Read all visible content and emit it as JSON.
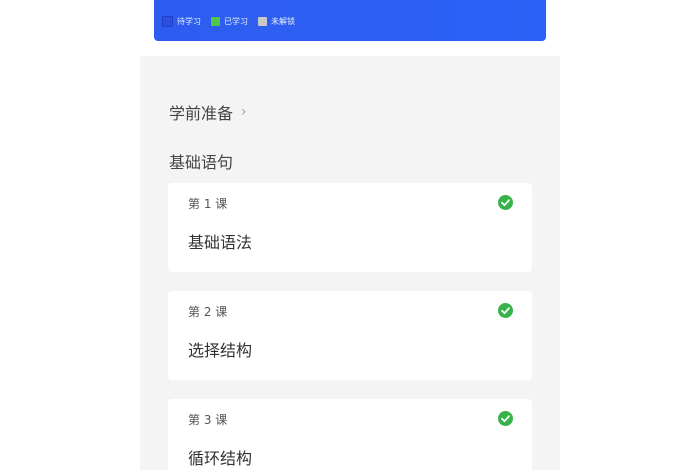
{
  "legend": {
    "items": [
      {
        "label": "待学习",
        "color": "#2b4fe0"
      },
      {
        "label": "已学习",
        "color": "#52c64a"
      },
      {
        "label": "未解锁",
        "color": "#c8c8c8"
      }
    ]
  },
  "pre_study": {
    "label": "学前准备",
    "chevron": "›"
  },
  "section": {
    "title": "基础语句"
  },
  "lessons": [
    {
      "number": "第 1 课",
      "name": "基础语法",
      "status_icon": "check-circle-icon",
      "status_color": "#37b34a"
    },
    {
      "number": "第 2 课",
      "name": "选择结构",
      "status_icon": "check-circle-icon",
      "status_color": "#37b34a"
    },
    {
      "number": "第 3 课",
      "name": "循环结构",
      "status_icon": "check-circle-icon",
      "status_color": "#37b34a"
    }
  ],
  "colors": {
    "banner": "#2f5cf0",
    "panel_bg": "#f4f4f5",
    "card_bg": "#ffffff"
  }
}
